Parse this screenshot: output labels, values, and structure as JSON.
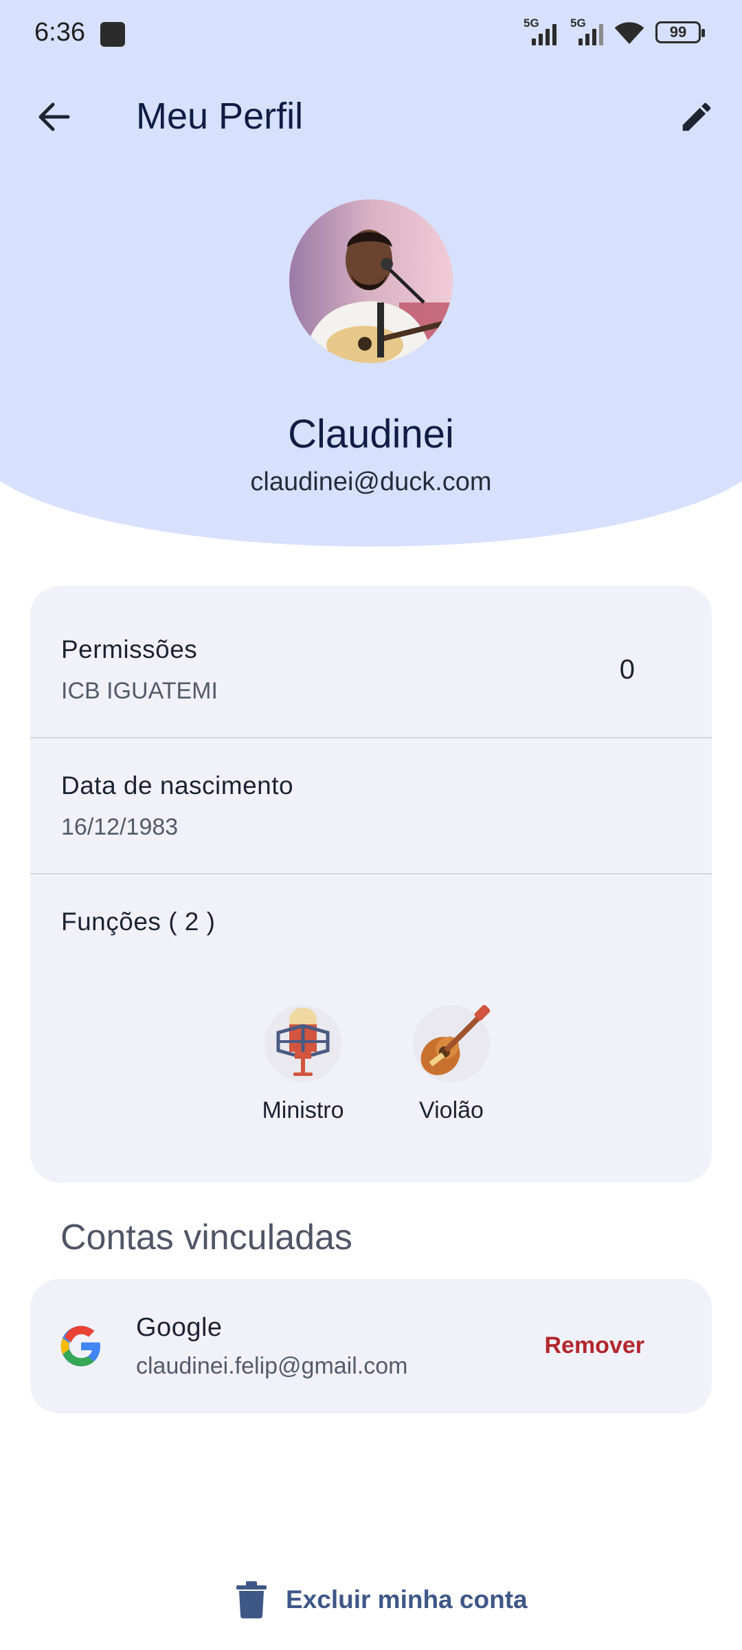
{
  "status_bar": {
    "time": "6:36",
    "network_1": "5G",
    "network_2": "5G",
    "battery": "99"
  },
  "app_bar": {
    "title": "Meu Perfil",
    "back_icon": "arrow-back-icon",
    "edit_icon": "pencil-icon"
  },
  "profile": {
    "name": "Claudinei",
    "email": "claudinei@duck.com"
  },
  "info": {
    "permissions_label": "Permissões",
    "permissions_org": "ICB IGUATEMI",
    "permissions_count": "0",
    "birth_label": "Data de nascimento",
    "birth_value": "16/12/1983",
    "roles_label": "Funções ( 2 )",
    "roles": [
      {
        "label": "Ministro",
        "icon": "microphone-icon"
      },
      {
        "label": "Violão",
        "icon": "guitar-icon"
      }
    ]
  },
  "linked_accounts": {
    "title": "Contas vinculadas",
    "items": [
      {
        "provider": "Google",
        "email": "claudinei.felip@gmail.com",
        "action": "Remover",
        "icon": "google-icon"
      }
    ]
  },
  "delete_account": {
    "label": "Excluir minha conta",
    "icon": "trash-icon"
  },
  "colors": {
    "header_bg": "#d7e0fd",
    "card_bg": "#f1f2f9",
    "title": "#0f1d44",
    "danger": "#b3262d",
    "delete_link": "#3f5787"
  }
}
